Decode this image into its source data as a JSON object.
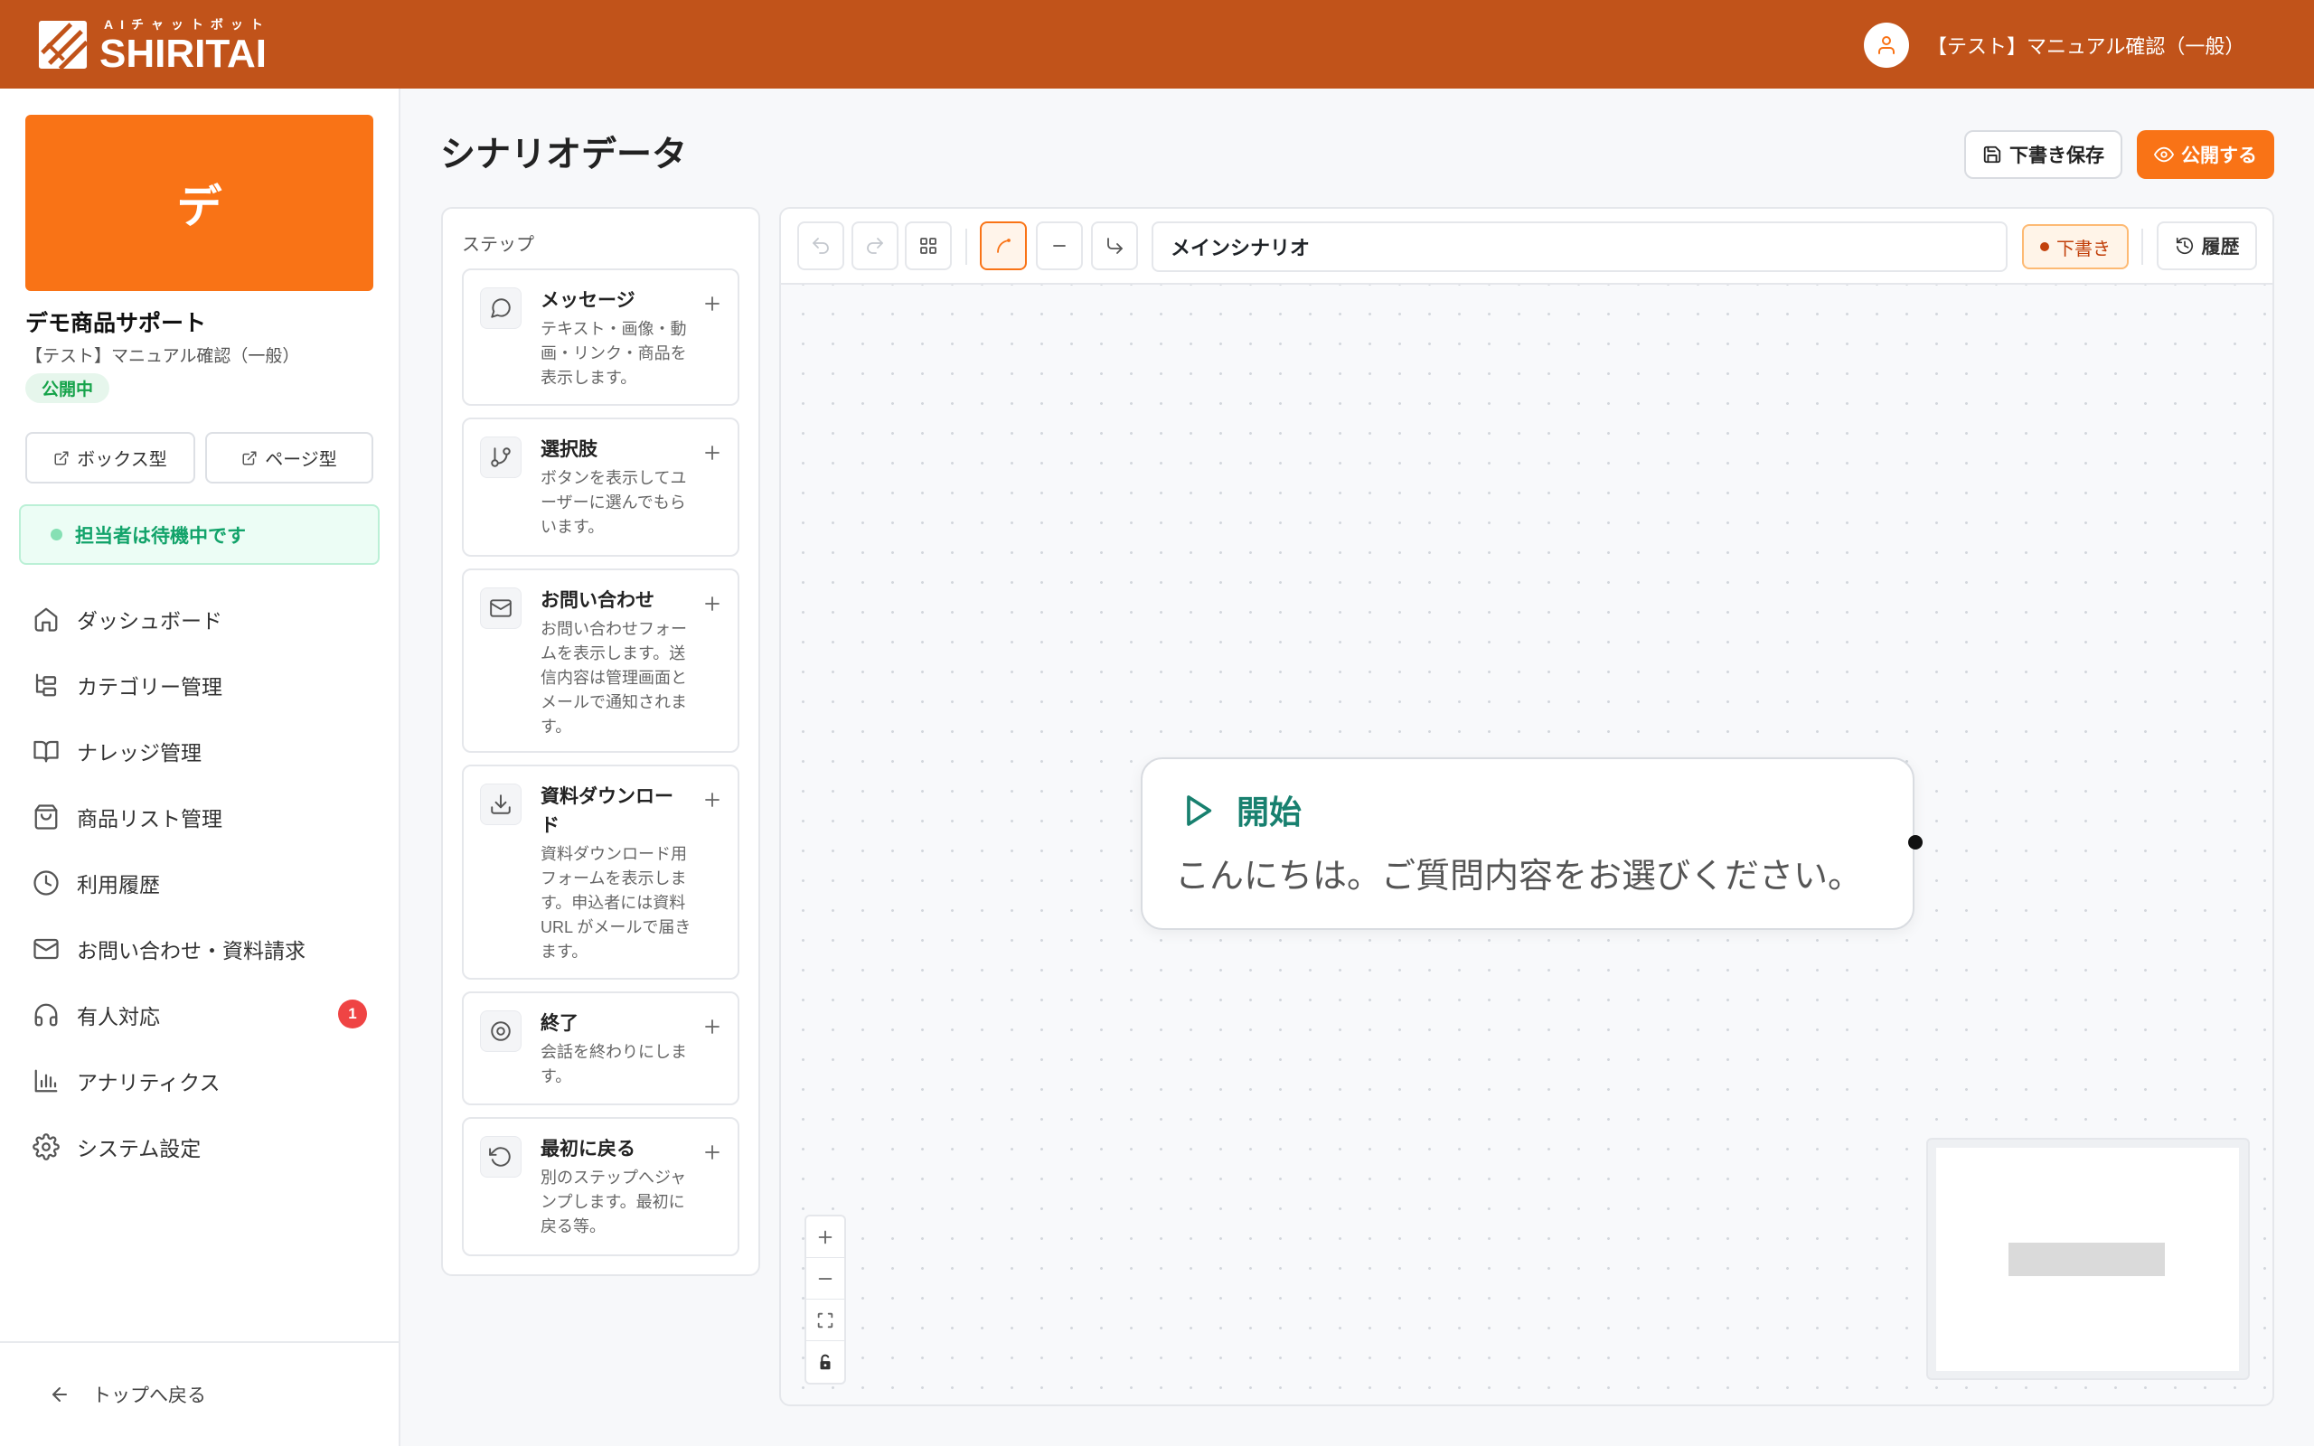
{
  "header": {
    "logo_tagline": "AIチャットボット",
    "logo_text": "SHIRITAI",
    "logo_icon": "notebook-pencil-logo-icon",
    "user_icon": "user-icon",
    "user_name": "【テスト】マニュアル確認（一般）"
  },
  "sidebar": {
    "bot_initial": "デ",
    "bot_name": "デモ商品サポート",
    "bot_owner": "【テスト】マニュアル確認（一般）",
    "bot_status": "公開中",
    "preview_buttons": [
      {
        "label": "ボックス型",
        "icon": "external-link-icon"
      },
      {
        "label": "ページ型",
        "icon": "external-link-icon"
      }
    ],
    "operator_status": "担当者は待機中です",
    "nav": [
      {
        "label": "ダッシュボード",
        "icon": "home-icon"
      },
      {
        "label": "カテゴリー管理",
        "icon": "folder-tree-icon"
      },
      {
        "label": "ナレッジ管理",
        "icon": "book-open-icon"
      },
      {
        "label": "商品リスト管理",
        "icon": "shopping-bag-icon"
      },
      {
        "label": "利用履歴",
        "icon": "clock-icon"
      },
      {
        "label": "お問い合わせ・資料請求",
        "icon": "mail-icon"
      },
      {
        "label": "有人対応",
        "icon": "headphones-icon",
        "badge": "1"
      },
      {
        "label": "アナリティクス",
        "icon": "bar-chart-icon"
      },
      {
        "label": "システム設定",
        "icon": "gear-icon"
      }
    ],
    "back_label": "トップへ戻る",
    "back_icon": "arrow-left-icon"
  },
  "page": {
    "title": "シナリオデータ",
    "save_draft": {
      "label": "下書き保存",
      "icon": "save-icon"
    },
    "publish": {
      "label": "公開する",
      "icon": "eye-icon"
    }
  },
  "steps": {
    "heading": "ステップ",
    "add_icon": "plus-icon",
    "items": [
      {
        "title": "メッセージ",
        "description": "テキスト・画像・動画・リンク・商品を表示します。",
        "icon": "message-circle-icon"
      },
      {
        "title": "選択肢",
        "description": "ボタンを表示してユーザーに選んでもらいます。",
        "icon": "git-branch-icon"
      },
      {
        "title": "お問い合わせ",
        "description": "お問い合わせフォームを表示します。送信内容は管理画面とメールで通知されます。",
        "icon": "mail-icon"
      },
      {
        "title": "資料ダウンロード",
        "description": "資料ダウンロード用フォームを表示します。申込者には資料URL がメールで届きます。",
        "icon": "download-icon"
      },
      {
        "title": "終了",
        "description": "会話を終わりにします。",
        "icon": "stop-circle-icon"
      },
      {
        "title": "最初に戻る",
        "description": "別のステップへジャンプします。最初に戻る等。",
        "icon": "rotate-ccw-icon"
      }
    ]
  },
  "editor": {
    "toolbar_icons": [
      "undo-icon",
      "redo-icon",
      "auto-layout-grid-icon",
      "curve-edge-icon",
      "straight-edge-icon",
      "step-edge-icon"
    ],
    "selected_edge_icon": "curve-edge-icon",
    "scenario_name": "メインシナリオ",
    "status_badge": "下書き",
    "history": {
      "label": "履歴",
      "icon": "history-icon"
    },
    "start_node": {
      "icon": "play-icon",
      "title": "開始",
      "message": "こんにちは。ご質問内容をお選びください。"
    },
    "zoom_controls": [
      "zoom-in-icon",
      "zoom-out-icon",
      "fit-view-icon",
      "lock-icon"
    ]
  },
  "colors": {
    "header": "#C1531A",
    "accent": "#F97316",
    "start_node": "#18806F",
    "published_green": "#16A34A",
    "draft_badge": "#C2410C",
    "notification_red": "#EF4444"
  }
}
